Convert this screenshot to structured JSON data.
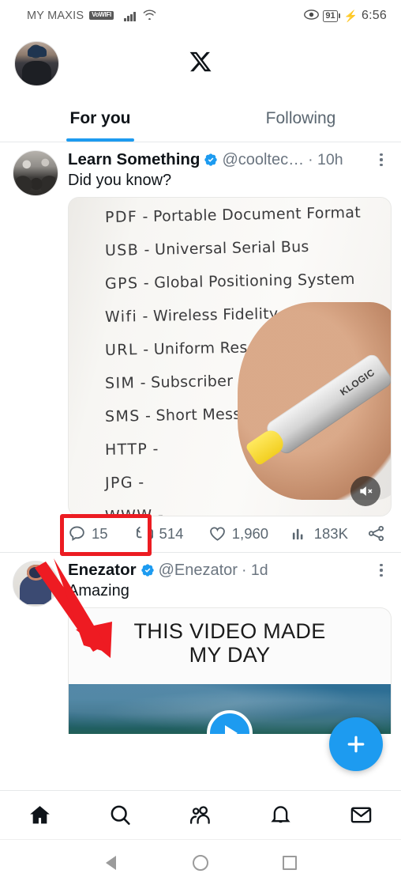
{
  "status_bar": {
    "carrier": "MY MAXIS",
    "network_badge": "VoWIFI",
    "signal_icon": "signal-bars-icon",
    "wifi_icon": "wifi-icon",
    "eye_icon": "eye-icon",
    "battery_level": "91",
    "charging_icon": "charging-bolt-icon",
    "time": "6:56"
  },
  "header": {
    "avatar_alt": "profile-avatar",
    "logo": "x-logo"
  },
  "tabs": [
    {
      "label": "For you",
      "active": true
    },
    {
      "label": "Following",
      "active": false
    }
  ],
  "tweets": [
    {
      "author": "Learn Something",
      "verified": true,
      "handle": "@cooltec…",
      "time": "· 10h",
      "text": "Did you know?",
      "media": {
        "type": "video",
        "muted": true,
        "lines": [
          {
            "abbr": "PDF",
            "meaning": "Portable Document Format"
          },
          {
            "abbr": "USB",
            "meaning": "Universal Serial Bus"
          },
          {
            "abbr": "GPS",
            "meaning": "Global Positioning System"
          },
          {
            "abbr": "Wifi",
            "meaning": "Wireless Fidelity"
          },
          {
            "abbr": "URL",
            "meaning": "Uniform Resource Locator"
          },
          {
            "abbr": "SIM",
            "meaning": "Subscriber Identity Module"
          },
          {
            "abbr": "SMS",
            "meaning": "Short Message S"
          },
          {
            "abbr": "HTTP",
            "meaning": ""
          },
          {
            "abbr": "JPG",
            "meaning": ""
          },
          {
            "abbr": "WWW",
            "meaning": ""
          }
        ],
        "pen_brand": "KLOGIC"
      },
      "actions": {
        "reply": "15",
        "repost": "514",
        "like": "1,960",
        "views": "183K",
        "share": ""
      }
    },
    {
      "author": "Enezator",
      "verified": true,
      "handle": "@Enezator",
      "time": "· 1d",
      "text": "Amazing",
      "media": {
        "type": "video",
        "title_line1": "THIS VIDEO MADE",
        "title_line2": "MY DAY"
      }
    }
  ],
  "annotation": {
    "arrow": "red-arrow-annotation",
    "highlight_target": "reply-count",
    "color": "#ec1c22"
  },
  "compose": {
    "icon": "plus-icon",
    "color": "#1d9bf0"
  },
  "bottom_nav": [
    {
      "name": "home",
      "icon": "home-icon",
      "active": true
    },
    {
      "name": "search",
      "icon": "search-icon",
      "active": false
    },
    {
      "name": "communities",
      "icon": "communities-icon",
      "active": false
    },
    {
      "name": "notifications",
      "icon": "bell-icon",
      "active": false
    },
    {
      "name": "messages",
      "icon": "envelope-icon",
      "active": false
    }
  ],
  "android_nav": [
    {
      "name": "back",
      "icon": "triangle-back-icon"
    },
    {
      "name": "home",
      "icon": "circle-home-icon"
    },
    {
      "name": "recents",
      "icon": "square-recents-icon"
    }
  ]
}
